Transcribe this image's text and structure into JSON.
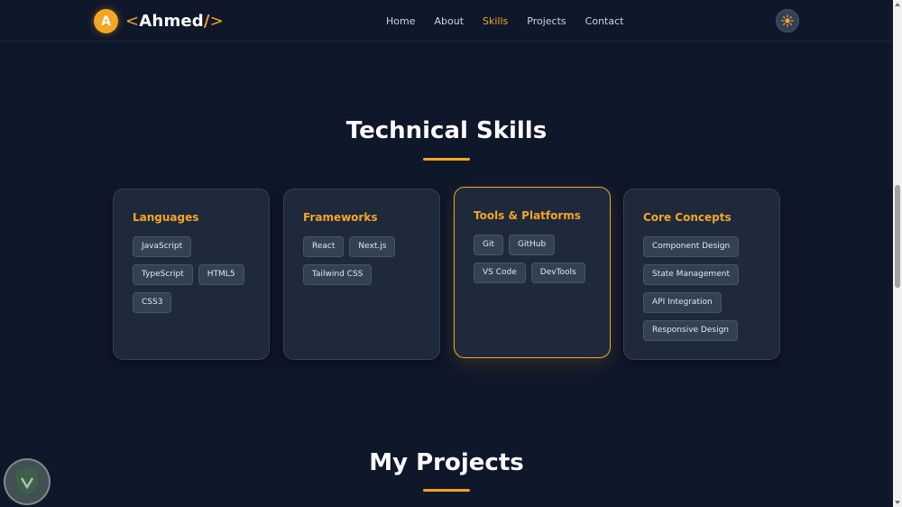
{
  "header": {
    "logo_initial": "A",
    "logo_open": "<",
    "logo_name": "Ahmed",
    "logo_slash": "/",
    "logo_close": ">",
    "nav": [
      {
        "label": "Home"
      },
      {
        "label": "About"
      },
      {
        "label": "Skills",
        "active": true
      },
      {
        "label": "Projects"
      },
      {
        "label": "Contact"
      }
    ],
    "theme_toggle_icon": "sun-icon"
  },
  "skills": {
    "title": "Technical Skills",
    "cards": [
      {
        "title": "Languages",
        "items": [
          "JavaScript",
          "TypeScript",
          "HTML5",
          "CSS3"
        ]
      },
      {
        "title": "Frameworks",
        "items": [
          "React",
          "Next.js",
          "Tailwind CSS"
        ]
      },
      {
        "title": "Tools & Platforms",
        "items": [
          "Git",
          "GitHub",
          "VS Code",
          "DevTools"
        ],
        "highlighted": true
      },
      {
        "title": "Core Concepts",
        "items": [
          "Component Design",
          "State Management",
          "API Integration",
          "Responsive Design"
        ]
      }
    ]
  },
  "projects": {
    "title": "My Projects"
  },
  "colors": {
    "background": "#0f172a",
    "card": "#1e293b",
    "accent": "#f5a524"
  }
}
